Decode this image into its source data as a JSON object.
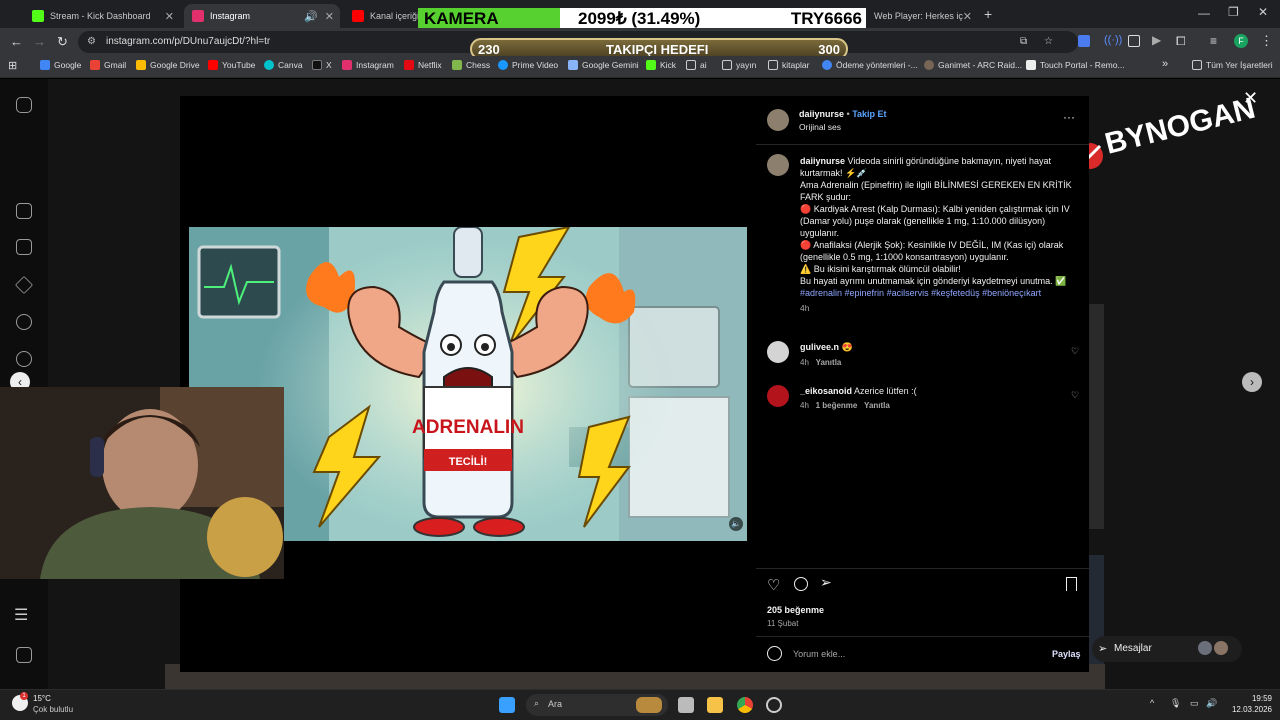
{
  "tabs": [
    {
      "title": "Stream - Kick Dashboard",
      "color": "#53fc18"
    },
    {
      "title": "Instagram",
      "color": "#e1306c"
    },
    {
      "title": "Kanal içeriği - Y",
      "color": "#ff0000"
    },
    {
      "title": "Web Player: Herkes iç",
      "color": "#1db954"
    }
  ],
  "address": {
    "url": "instagram.com/p/DUnu7aujcDt/?hl=tr"
  },
  "bookmarks": [
    "Google",
    "Gmail",
    "Google Drive",
    "YouTube",
    "Canva",
    "X",
    "Instagram",
    "Netflix",
    "Chess",
    "Prime Video",
    "Google Gemini",
    "Kick",
    "ai",
    "yayın",
    "kitaplar",
    "Ödeme yöntemleri -...",
    "Ganimet - ARC Raid...",
    "Touch Portal - Remo..."
  ],
  "bookmarks_all": "Tüm Yer İşaretleri",
  "kamera": {
    "label": "KAMERA",
    "amount": "2099₺ (31.49%)",
    "code": "TRY6666"
  },
  "goal": {
    "start": "230",
    "label": "TAKIPÇI HEDEFI",
    "end": "300"
  },
  "watermark": "BYNOGAN",
  "post": {
    "author": "daiiynurse",
    "dot": "•",
    "follow": "Takip Et",
    "audio": "Orijinal ses",
    "caption_intro": "Videoda sinirli göründüğüne bakmayın, niyeti hayat kurtarmak! ⚡💉",
    "caption_lines": [
      "Ama Adrenalin (Epinefrin) ile ilgili BİLİNMESİ GEREKEN EN KRİTİK FARK şudur:",
      "🔴 Kardiyak Arrest (Kalp Durması): Kalbi yeniden çalıştırmak için IV (Damar yolu) puşe olarak (genellikle 1 mg, 1:10.000 dilüsyon) uygulanır.",
      "🔴 Anafilaksi (Alerjik Şok): Kesinlikle IV DEĞİL, IM (Kas içi) olarak (genellikle 0.5 mg, 1:1000 konsantrasyon) uygulanır.",
      "⚠️ Bu ikisini karıştırmak ölümcül olabilir!",
      "Bu hayati ayrımı unutmamak için gönderiyi kaydetmeyi unutma. ✅"
    ],
    "hashtags": "#adrenalin #epinefrin #acilservis #keşfetedüş #beniöneçıkart",
    "caption_time": "4h",
    "likes": "205 beğenme",
    "date": "11 Şubat",
    "comment_placeholder": "Yorum ekle...",
    "share": "Paylaş"
  },
  "comments": [
    {
      "user": "gulivee.n",
      "text": "😍",
      "time": "4h",
      "likes": "",
      "reply": "Yanıtla"
    },
    {
      "user": "_eikosanoid",
      "text": "Azerice lütfen :(",
      "time": "4h",
      "likes": "1 beğenme",
      "reply": "Yanıtla"
    }
  ],
  "video": {
    "bottle_label": "ADRENALIN",
    "tag": "TECİLİ!"
  },
  "messages": "Mesajlar",
  "weather": {
    "temp": "15°C",
    "desc": "Çok bulutlu"
  },
  "taskbar": {
    "search": "Ara",
    "time": "19:59",
    "date": "12.03.2026",
    "badge": "1"
  }
}
